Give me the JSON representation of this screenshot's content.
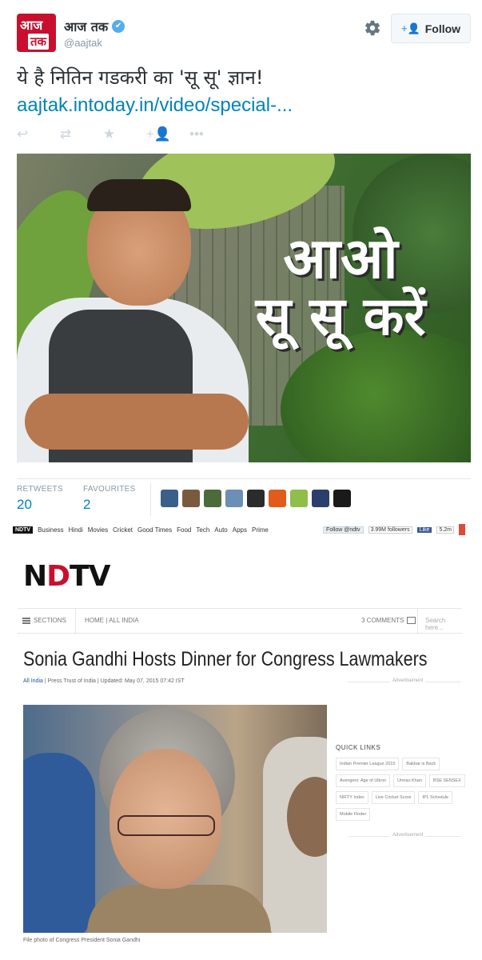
{
  "tweet": {
    "display_name": "आज तक",
    "handle": "@aajtak",
    "avatar_top": "आज",
    "avatar_bottom": "तक",
    "follow_label": "Follow",
    "text": "ये है नितिन गडकरी का 'सू सू' ज्ञान!",
    "link": "aajtak.intoday.in/video/special-...",
    "image_headline_line1": "आओ",
    "image_headline_line2": "सू सू करें",
    "stats": {
      "retweets_label": "RETWEETS",
      "retweets_count": "20",
      "favourites_label": "FAVOURITES",
      "favourites_count": "2"
    },
    "favoriter_colors": [
      "#3a5f8a",
      "#7a5a3f",
      "#4b6b3a",
      "#6b8fb5",
      "#2b2b2b",
      "#e35b1b",
      "#8fbf4a",
      "#2c3e6b",
      "#1a1a1a"
    ],
    "icons": [
      "reply-icon",
      "retweet-icon",
      "favorite-icon",
      "follow-icon",
      "more-icon"
    ]
  },
  "ndtv": {
    "topbar": {
      "logo": "NDTV",
      "nav": [
        "Business",
        "Hindi",
        "Movies",
        "Cricket",
        "Good Times",
        "Food",
        "Tech",
        "Auto",
        "Apps",
        "Prime"
      ],
      "twitter_follow": "Follow @ndtv",
      "followers": "3.99M followers",
      "like": "Like",
      "like_count": "5.2m"
    },
    "logo": "NDTV",
    "sections_label": "SECTIONS",
    "breadcrumb": "HOME | ALL INDIA",
    "comments": "3 COMMENTS",
    "search_placeholder": "Search here...",
    "title": "Sonia Gandhi Hosts Dinner for Congress Lawmakers",
    "byline_link": "All India",
    "byline_rest": " | Press Trust of India | Updated: May 07, 2015 07:42 IST",
    "advertisement": "Advertisement",
    "caption": "File photo of Congress President Sonia Gandhi",
    "quick_links_title": "QUICK LINKS",
    "quick_links": [
      "Indian Premier League 2015",
      "Bakbar is Back",
      "Avengers: Age of Ultron",
      "Umrao Khan",
      "BSE SENSEX",
      "NIFTY Index",
      "Live Cricket Score",
      "IPL Schedule",
      "Mobile Finder"
    ]
  }
}
